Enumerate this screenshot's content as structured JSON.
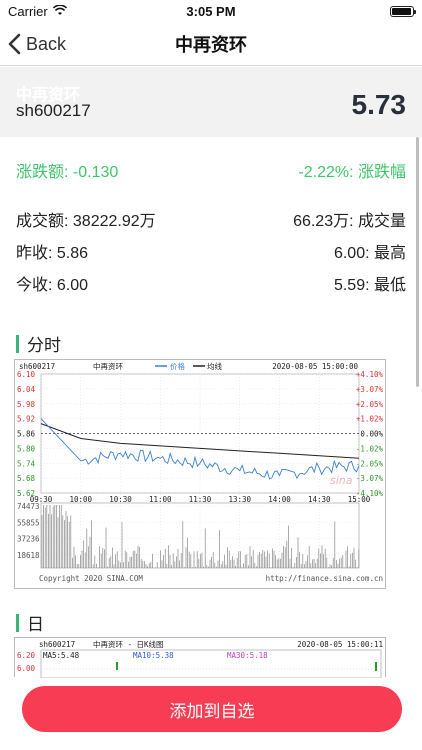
{
  "status_bar": {
    "carrier": "Carrier",
    "time": "3:05 PM",
    "battery_level": 0.95
  },
  "nav": {
    "back_label": "Back",
    "title": "中再资环"
  },
  "quote": {
    "name": "中再资环",
    "code": "sh600217",
    "price": "5.73",
    "change_label": "涨跌额: -0.130",
    "change_pct_label": "-2.22%: 涨跌幅",
    "turnover_label": "成交额: 38222.92万",
    "volume_label": "66.23万: 成交量",
    "prev_close_label": "昨收: 5.86",
    "high_label": "6.00: 最高",
    "open_label": "今收: 6.00",
    "low_label": "5.59: 最低"
  },
  "sections": {
    "intraday": "分时",
    "daily": "日"
  },
  "intraday_chart": {
    "code": "sh600217",
    "name": "中再资环",
    "legend_price": "价格",
    "legend_avg": "均线",
    "datetime": "2020-08-05 15:00:00",
    "price_ticks": [
      "6.10",
      "6.04",
      "5.98",
      "5.92",
      "5.86",
      "5.80",
      "5.74",
      "5.68",
      "5.62"
    ],
    "pct_ticks": [
      "+4.10%",
      "+3.07%",
      "+2.05%",
      "+1.02%",
      "0.00%",
      "-1.02%",
      "-2.05%",
      "-3.07%",
      "-4.10%"
    ],
    "time_ticks": [
      "09:30",
      "10:00",
      "10:30",
      "11:00",
      "11:30",
      "13:30",
      "14:00",
      "14:30",
      "15:00"
    ],
    "volume_ticks": [
      "74473",
      "55855",
      "37236",
      "18618"
    ],
    "copyright": "Copyright 2020 SINA.COM",
    "source": "http://finance.sina.com.cn",
    "watermark": "sina",
    "colors": {
      "price": "#3b7fd4",
      "avg": "#222222",
      "up": "#e03030",
      "down": "#2a9a2a"
    }
  },
  "daily_chart": {
    "code": "sh600217",
    "name": "中再资环 - 日K线图",
    "datetime": "2020-08-05 15:00:11",
    "ma5": "MA5:5.48",
    "ma10": "MA10:5.38",
    "ma30": "MA30:5.18",
    "price_ticks": [
      "6.20",
      "6.00"
    ]
  },
  "chart_data": {
    "type": "line",
    "title": "",
    "xlabel": "",
    "ylabel": "",
    "x": [
      "09:30",
      "10:00",
      "10:30",
      "11:00",
      "11:30",
      "13:30",
      "14:00",
      "14:30",
      "15:00"
    ],
    "ylim": [
      5.62,
      6.1
    ],
    "series": [
      {
        "name": "价格",
        "values": [
          5.92,
          5.75,
          5.78,
          5.76,
          5.74,
          5.71,
          5.69,
          5.72,
          5.73
        ]
      },
      {
        "name": "均线",
        "values": [
          5.9,
          5.84,
          5.82,
          5.81,
          5.8,
          5.79,
          5.78,
          5.77,
          5.76
        ]
      }
    ],
    "prev_close": 5.86
  },
  "action": {
    "add_watch_label": "添加到自选"
  }
}
